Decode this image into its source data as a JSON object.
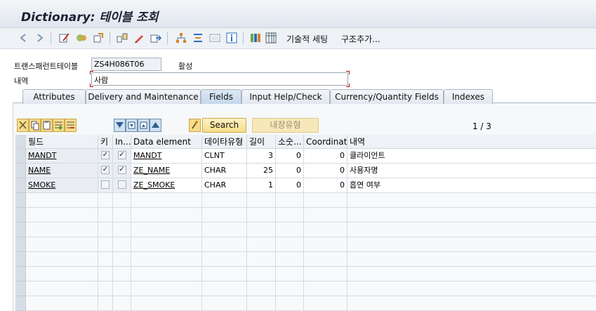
{
  "window": {
    "title": "Dictionary: 테이블 조회"
  },
  "toolbar": {
    "icons": [
      "back-arrow-icon",
      "forward-arrow-icon",
      "display-change-icon",
      "active-inactive-icon",
      "other-object-icon",
      "where-used-icon",
      "edit-icon",
      "navigate-icon",
      "hierarchy-icon",
      "align-icon",
      "frame-icon",
      "info-icon",
      "columns-icon",
      "table-icon"
    ],
    "technical_settings_label": "기술적 세팅",
    "append_structure_label": "구조추가..."
  },
  "header": {
    "transparent_table_label": "트랜스패런트테이블",
    "table_name": "ZS4H086T06",
    "status": "활성",
    "description_label": "내역",
    "description_value": "사람"
  },
  "tabs": [
    {
      "label": "Attributes",
      "active": false
    },
    {
      "label": "Delivery and Maintenance",
      "active": false
    },
    {
      "label": "Fields",
      "active": true
    },
    {
      "label": "Input Help/Check",
      "active": false
    },
    {
      "label": "Currency/Quantity Fields",
      "active": false
    },
    {
      "label": "Indexes",
      "active": false
    }
  ],
  "table_toolbar": {
    "search_label": "Search",
    "builtin_type_label": "내장유형",
    "pager": "1 / 3"
  },
  "columns": [
    "필드",
    "키",
    "In...",
    "Data element",
    "데이타유형",
    "길이",
    "소숫...",
    "Coordinate",
    "내역"
  ],
  "rows": [
    {
      "field": "MANDT",
      "key": true,
      "initial": true,
      "data_element": "MANDT",
      "data_type": "CLNT",
      "length": "3",
      "decimals": "0",
      "coordinate": "0",
      "description": "클라이언트"
    },
    {
      "field": "NAME",
      "key": true,
      "initial": true,
      "data_element": "ZE_NAME",
      "data_type": "CHAR",
      "length": "25",
      "decimals": "0",
      "coordinate": "0",
      "description": "사용자명"
    },
    {
      "field": "SMOKE",
      "key": false,
      "initial": false,
      "data_element": "ZE_SMOKE",
      "data_type": "CHAR",
      "length": "1",
      "decimals": "0",
      "coordinate": "0",
      "description": "흡연 여부"
    }
  ],
  "colors": {
    "title": "#1a2233",
    "button": "#f6dc8a",
    "required": "#c00000"
  }
}
